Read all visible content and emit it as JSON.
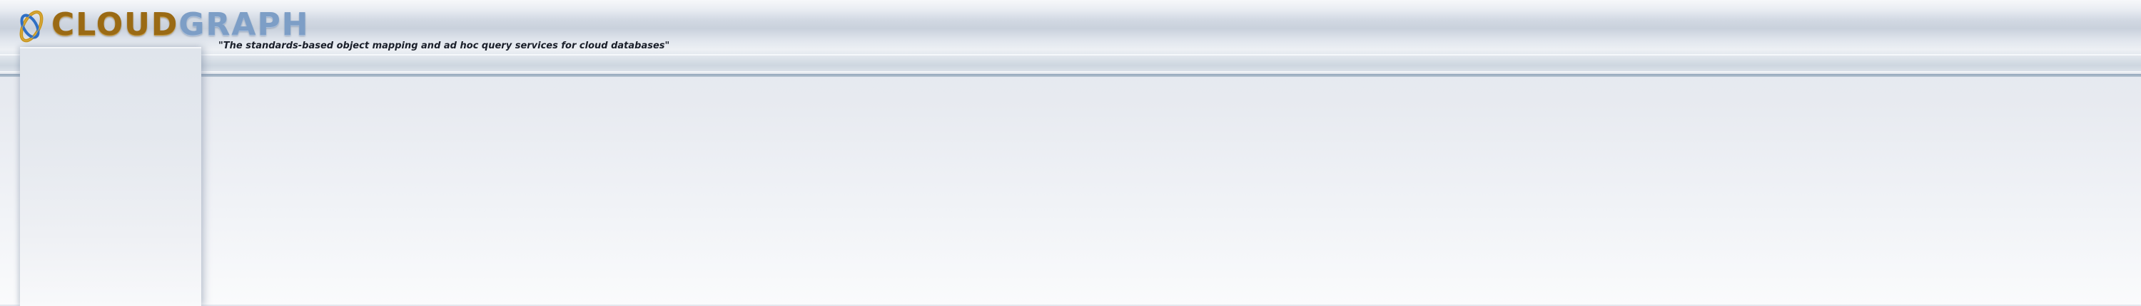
{
  "header": {
    "logo": {
      "icon": "cloudgraph-logo-icon",
      "text_part_1": "CLOUD",
      "text_part_2": "GRAPH"
    },
    "tagline": "\"The standards-based object mapping and ad hoc query services for cloud databases\""
  },
  "colors": {
    "logo_gold": "#9a6a14",
    "logo_blue": "#7d9ec6",
    "header_rule": "#8fa3b8",
    "page_background": "#e7eaf0"
  }
}
